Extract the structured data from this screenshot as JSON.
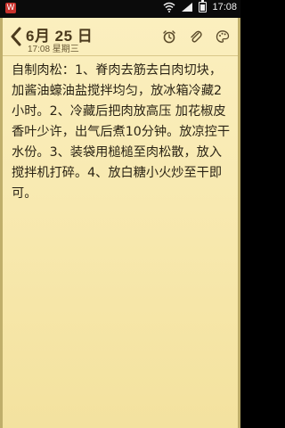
{
  "status_bar": {
    "app_badge": "W",
    "time": "17:08",
    "icons": [
      "wifi-icon",
      "signal-icon",
      "battery-icon"
    ]
  },
  "note": {
    "date_title": "6月 25 日",
    "subtitle": "17:08 星期三",
    "tools": [
      "alarm-icon",
      "attachment-icon",
      "palette-icon"
    ],
    "body": "自制肉松：1、脊肉去筋去白肉切块，加酱油蠔油盐搅拌均匀，放冰箱冷藏2小时。2、冷藏后把肉放高压 加花椒皮香叶少许，出气后煮10分钟。放凉控干水份。3、装袋用槌槌至肉松散，放入搅拌机打碎。4、放白糖小火炒至干即可。"
  },
  "colors": {
    "paper": "#f6e6a8",
    "text": "#2b2415",
    "header_text": "#4b3a1d",
    "status_bar": "#0b0b0b"
  }
}
